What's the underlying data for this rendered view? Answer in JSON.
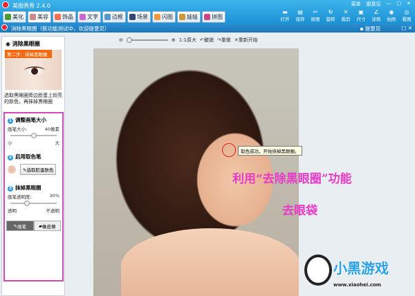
{
  "app": {
    "title": "美图秀秀 2.4.0",
    "menu": "菜单",
    "feedback": "提意见"
  },
  "tabs": [
    {
      "label": "美化",
      "color": "#4a9a3a"
    },
    {
      "label": "美容",
      "color": "#c88",
      "active": true
    },
    {
      "label": "饰品",
      "color": "#f07050"
    },
    {
      "label": "文字",
      "color": "#c6c"
    },
    {
      "label": "边框",
      "color": "#59c"
    },
    {
      "label": "场景",
      "color": "#347"
    },
    {
      "label": "闪图",
      "color": "#e94"
    },
    {
      "label": "娃娃",
      "color": "#c93"
    },
    {
      "label": "拼图",
      "color": "#c48"
    }
  ],
  "tools": [
    "打开",
    "保存",
    "抠图",
    "旋转",
    "裁剪",
    "尺寸",
    "涂鸦",
    "拍照",
    "看图"
  ],
  "subwindow": {
    "title": "消除黑眼圈（新功能测试中，欢迎提意见）",
    "feedback": "提意见"
  },
  "zoom": {
    "actual": "1:1原大",
    "undo": "撤销",
    "redo": "重做",
    "restart": "重新开始"
  },
  "panel": {
    "title": "消除黑眼圈",
    "banner": "第二步：抹掉黑眼圈",
    "desc": "选取黑眼圈旁边脸蛋上较亮的肤色，再抹掉黑眼圈",
    "step1": {
      "num": "1",
      "title": "调整画笔大小",
      "label": "画笔大小:",
      "value": "40像素",
      "min": "小",
      "max": "大",
      "level": 0.45
    },
    "step2": {
      "num": "2",
      "title": "启用取色笔",
      "button": "选取脸蛋肤色"
    },
    "step3": {
      "num": "3",
      "title": "抹掉黑眼圈",
      "label": "画笔透明度:",
      "value": "30%",
      "min": "透明",
      "max": "不透明",
      "level": 0.3
    },
    "modes": [
      "画笔",
      "橡皮擦"
    ]
  },
  "tooltip": "取色成功，开始抹掉黑眼圈。",
  "overlay": {
    "line1": "利用“去除黑眼圈”功能",
    "line2": "去眼袋"
  },
  "watermark": {
    "brand": "小黑游戏",
    "url": "www.xiaohei.com"
  }
}
